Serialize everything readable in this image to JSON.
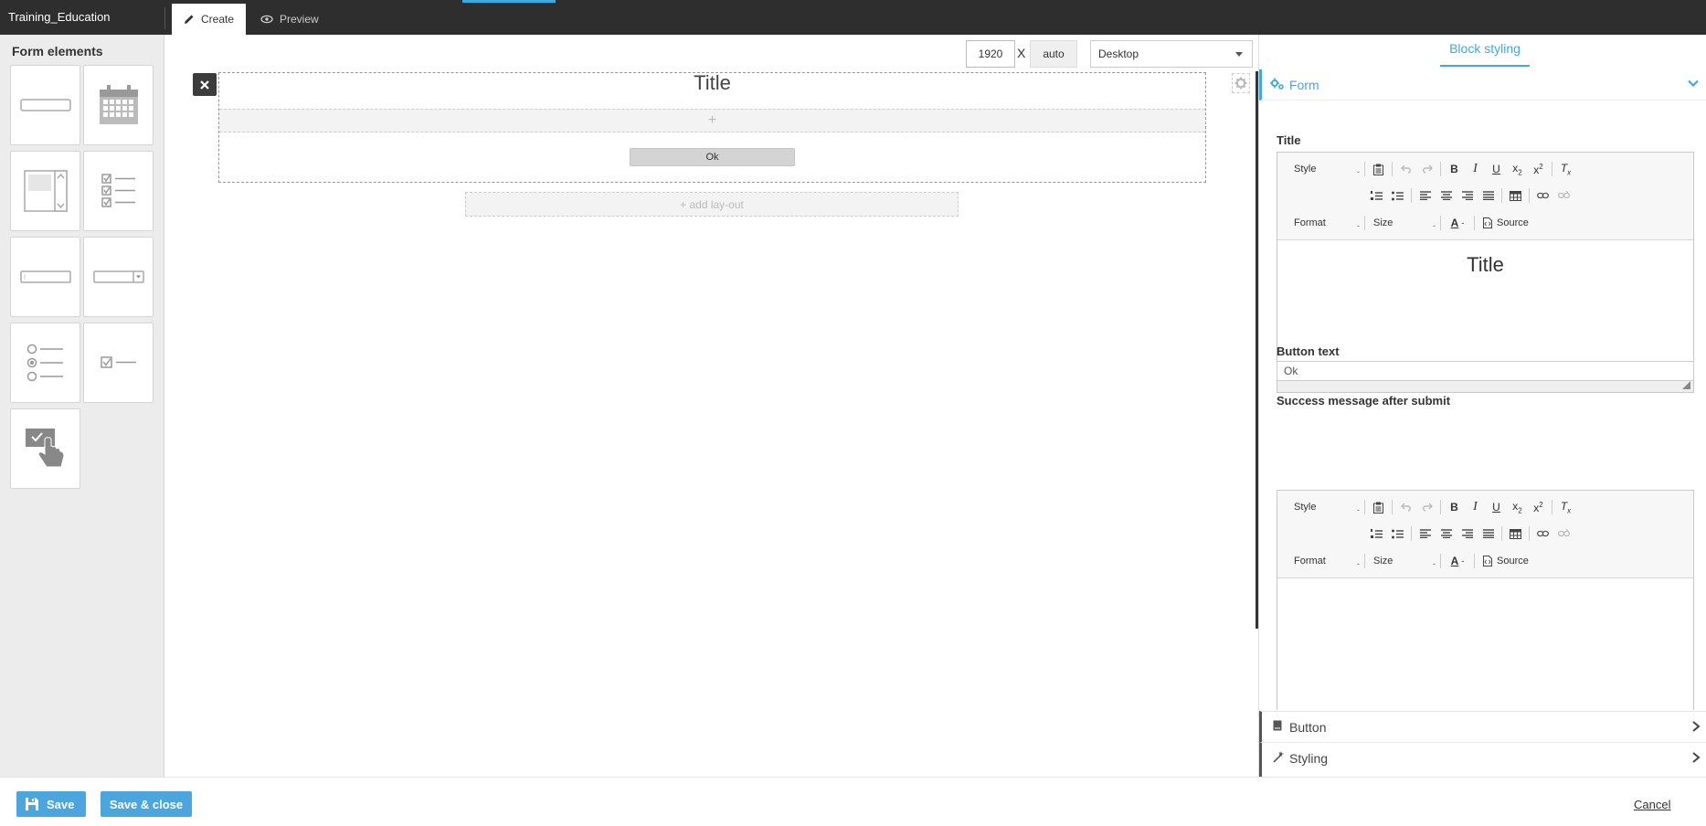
{
  "app": {
    "title": "Training_Education"
  },
  "tabs": {
    "create": "Create",
    "preview": "Preview"
  },
  "sidebar": {
    "heading": "Form elements",
    "tiles": [
      {
        "icon": "text-input-icon"
      },
      {
        "icon": "calendar-icon"
      },
      {
        "icon": "listbox-icon"
      },
      {
        "icon": "checkbox-list-icon"
      },
      {
        "icon": "input-field-icon"
      },
      {
        "icon": "dropdown-icon"
      },
      {
        "icon": "radio-list-icon"
      },
      {
        "icon": "single-checkbox-icon"
      },
      {
        "icon": "button-click-icon"
      }
    ]
  },
  "canvas": {
    "width_value": "1920",
    "x_sep": "X",
    "height_value": "auto",
    "device": "Desktop",
    "form_title": "Title",
    "add_row": "+",
    "ok_button": "Ok",
    "add_layout": "+ add lay-out"
  },
  "panel": {
    "tab": "Block styling",
    "form_section": "Form",
    "title_label": "Title",
    "title_content": "Title",
    "button_text_label": "Button text",
    "button_text_value": "Ok",
    "success_label": "Success message after submit",
    "button_section": "Button",
    "styling_section": "Styling",
    "editor": {
      "style": "Style",
      "format": "Format",
      "size": "Size",
      "source": "Source",
      "dash": "-"
    }
  },
  "footer": {
    "save": "Save",
    "save_close": "Save & close",
    "cancel": "Cancel"
  },
  "colors": {
    "accent": "#3fa9e0",
    "topbar": "#2e2e2e",
    "button": "#4ba6dd"
  }
}
